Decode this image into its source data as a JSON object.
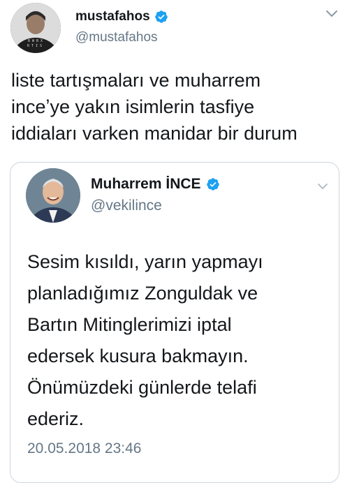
{
  "outer_tweet": {
    "display_name": "mustafahos",
    "handle": "@mustafahos",
    "avatar_icon": "profile-photo-man-in-hoodie",
    "text": "liste tartışmaları ve muharrem\ninceʼye yakın isimlerin tasfiye\niddiaları varken manidar bir durum"
  },
  "quoted_tweet": {
    "display_name": "Muharrem İNCE",
    "handle": "@vekilince",
    "avatar_icon": "profile-photo-smiling-man-in-suit",
    "text": "Sesim kısıldı, yarın yapmayı\nplanladığımız Zonguldak ve\nBartın Mitinglerimizi iptal\nedersek kusura bakmayın.\nÖnümüzdeki günlerde telafi\nederiz.",
    "timestamp": "20.05.2018 23:46"
  },
  "colors": {
    "verified_blue": "#1da1f2",
    "secondary_text": "#657786",
    "primary_text": "#14171a",
    "card_border": "#ccd6dd"
  }
}
